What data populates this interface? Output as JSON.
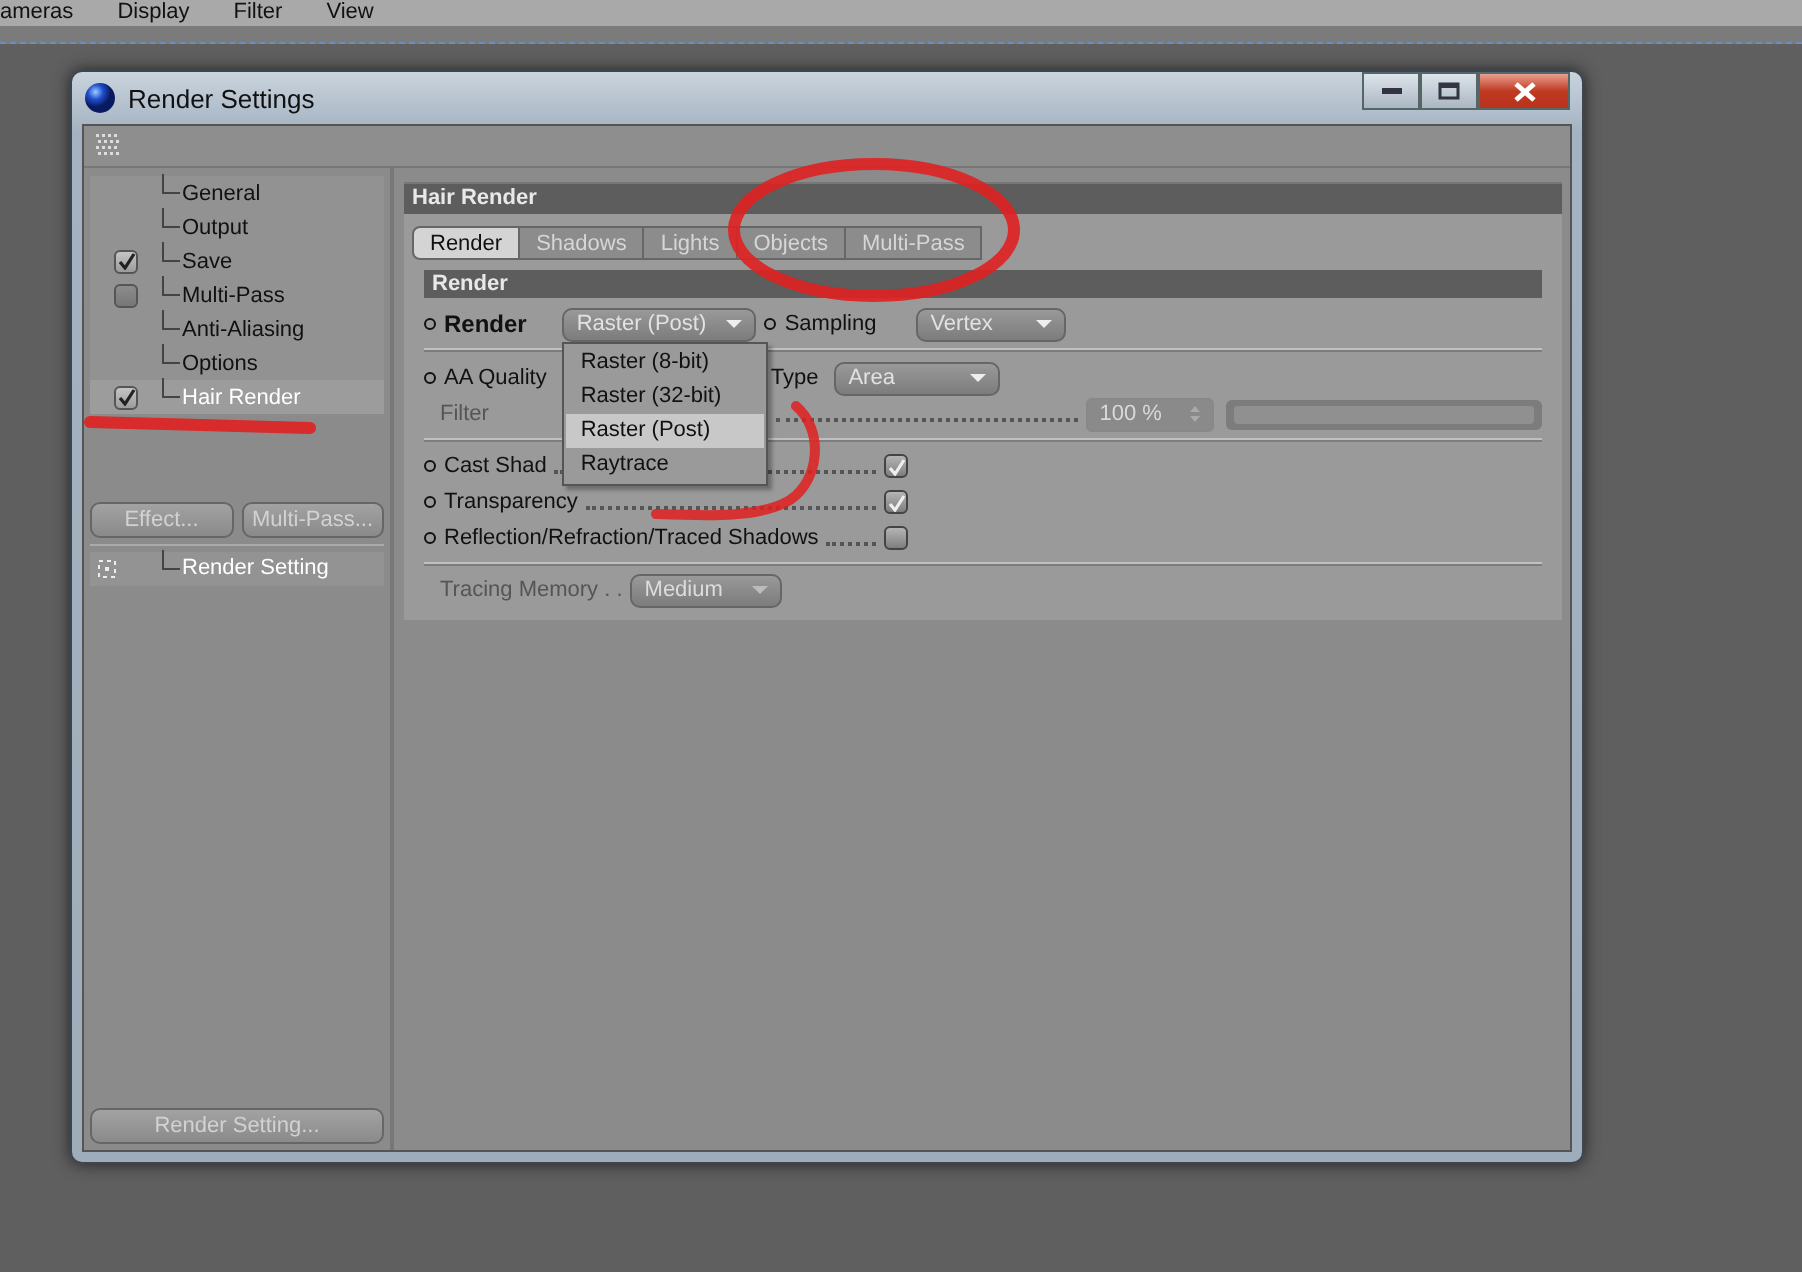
{
  "menu_bar": [
    "ameras",
    "Display",
    "Filter",
    "View"
  ],
  "window": {
    "title": "Render Settings"
  },
  "sidebar": {
    "items": [
      {
        "label": "General",
        "kind": "plain",
        "selected": false
      },
      {
        "label": "Output",
        "kind": "plain",
        "selected": false
      },
      {
        "label": "Save",
        "kind": "check",
        "checked": true,
        "selected": false
      },
      {
        "label": "Multi-Pass",
        "kind": "check",
        "checked": false,
        "selected": false
      },
      {
        "label": "Anti-Aliasing",
        "kind": "plain",
        "selected": false
      },
      {
        "label": "Options",
        "kind": "plain",
        "selected": false
      },
      {
        "label": "Hair Render",
        "kind": "check",
        "checked": true,
        "selected": true
      }
    ]
  },
  "sidebar_buttons": [
    "Effect...",
    "Multi-Pass..."
  ],
  "render_settings_list": [
    {
      "label": "Render Setting"
    }
  ],
  "render_setting_button": "Render Setting...",
  "panel": {
    "title": "Hair Render",
    "tabs": [
      {
        "label": "Render",
        "selected": true
      },
      {
        "label": "Shadows",
        "selected": false
      },
      {
        "label": "Lights",
        "selected": false
      },
      {
        "label": "Objects",
        "selected": false
      },
      {
        "label": "Multi-Pass",
        "selected": false
      }
    ],
    "section": "Render",
    "render_label": "Render",
    "render_value": "Raster (Post)",
    "render_options": [
      {
        "label": "Raster (8-bit)",
        "selected": false
      },
      {
        "label": "Raster (32-bit)",
        "selected": false
      },
      {
        "label": "Raster (Post)",
        "selected": true
      },
      {
        "label": "Raytrace",
        "selected": false
      }
    ],
    "sampling_label": "Sampling",
    "sampling_value": "Vertex",
    "aa_quality_label": "AA Quality",
    "type_label": "Type",
    "type_value": "Area",
    "filter_label": "Filter",
    "filter_value": "100 %",
    "filter_slider": {
      "level": 1
    },
    "checks": [
      {
        "label": "Cast Shad",
        "checked": true
      },
      {
        "label": "Transparency",
        "checked": true
      },
      {
        "label": "Reflection/Refraction/Traced Shadows",
        "checked": false
      }
    ],
    "tracing_memory_label": "Tracing Memory . .",
    "tracing_memory_value": "Medium"
  }
}
